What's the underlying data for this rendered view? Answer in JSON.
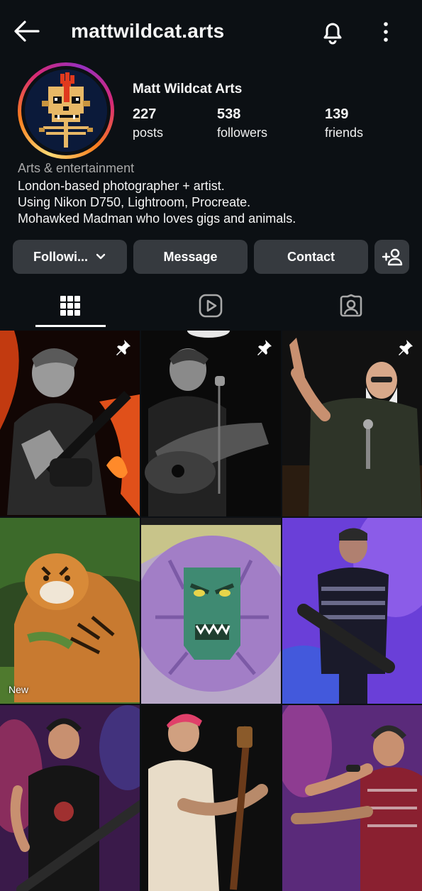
{
  "header": {
    "username": "mattwildcat.arts",
    "back_icon": "arrow-left-icon",
    "bell_icon": "bell-icon",
    "more_icon": "more-vertical-icon"
  },
  "profile": {
    "display_name": "Matt Wildcat Arts",
    "stats": [
      {
        "value": "227",
        "label": "posts"
      },
      {
        "value": "538",
        "label": "followers"
      },
      {
        "value": "139",
        "label": "friends"
      }
    ],
    "category": "Arts & entertainment",
    "bio": [
      "London-based photographer + artist.",
      "Using Nikon D750, Lightroom, Procreate.",
      "Mohawked Madman who loves gigs and animals."
    ]
  },
  "actions": {
    "following": "Followi...",
    "message": "Message",
    "contact": "Contact",
    "add_person_icon": "add-person-icon"
  },
  "tabs": [
    {
      "icon": "grid-icon",
      "active": true
    },
    {
      "icon": "reels-icon",
      "active": false
    },
    {
      "icon": "tagged-icon",
      "active": false
    }
  ],
  "posts": [
    {
      "pinned": true,
      "label": ""
    },
    {
      "pinned": true,
      "label": ""
    },
    {
      "pinned": true,
      "label": ""
    },
    {
      "pinned": false,
      "label": "New"
    },
    {
      "pinned": false,
      "label": ""
    },
    {
      "pinned": false,
      "label": ""
    },
    {
      "pinned": false,
      "label": ""
    },
    {
      "pinned": false,
      "label": ""
    },
    {
      "pinned": false,
      "label": ""
    }
  ],
  "colors": {
    "background": "#0c1014",
    "button": "#363a3f",
    "muted_text": "#a8a8a8"
  }
}
